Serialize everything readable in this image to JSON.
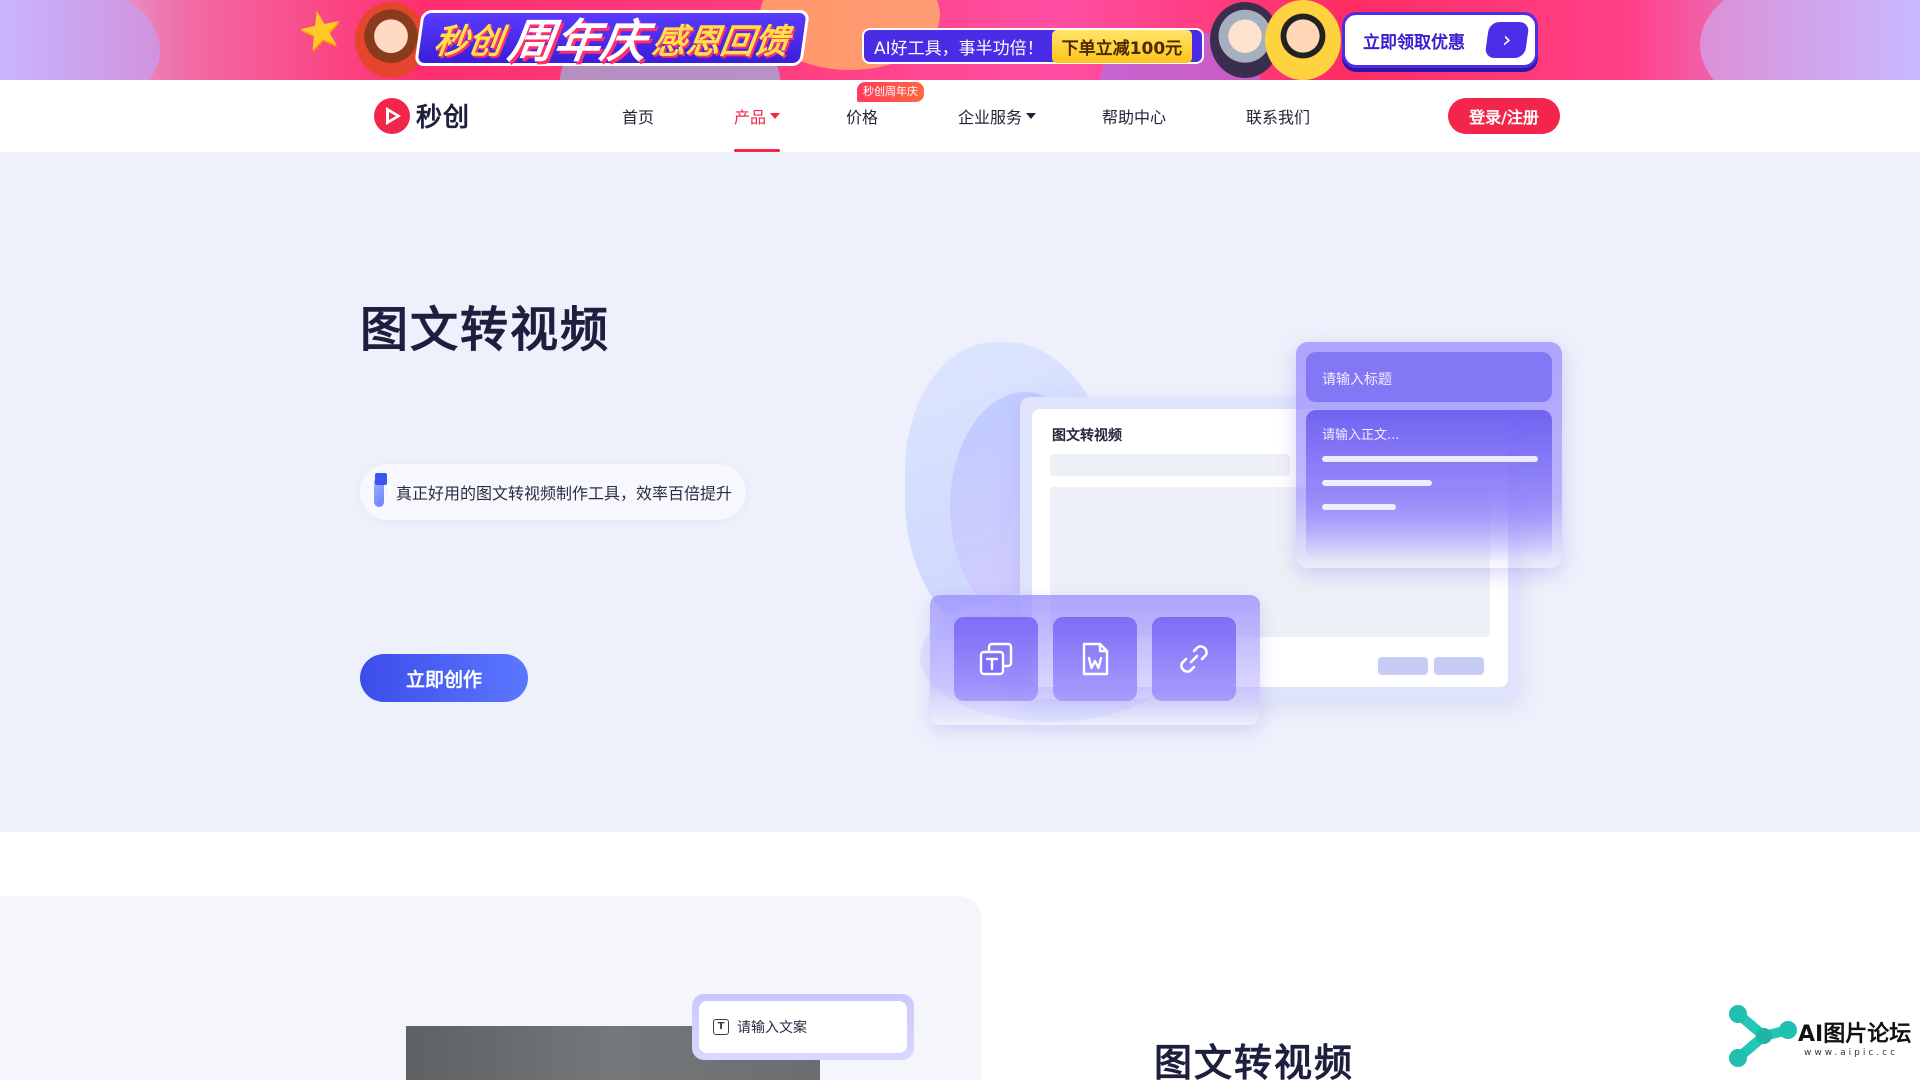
{
  "banner": {
    "title_part1": "秒创",
    "title_part2": "周年庆",
    "title_part3": "感恩回馈",
    "subtitle": "AI好工具，事半功倍！",
    "offer": "下单立减100元",
    "cta_label": "立即领取优惠",
    "colors": {
      "accent": "#4d2ee8",
      "brand": "#ff2f6f"
    }
  },
  "nav": {
    "logo_text": "秒创",
    "items": [
      {
        "label": "首页"
      },
      {
        "label": "产品",
        "active": true,
        "has_dropdown": true
      },
      {
        "label": "价格",
        "badge": "秒创周年庆"
      },
      {
        "label": "企业服务",
        "has_dropdown": true
      },
      {
        "label": "帮助中心"
      },
      {
        "label": "联系我们"
      }
    ],
    "login_label": "登录/注册",
    "colors": {
      "brand": "#f2264a"
    }
  },
  "hero": {
    "title": "图文转视频",
    "tagline": "真正好用的图文转视频制作工具，效率百倍提升",
    "cta_label": "立即创作",
    "illustration": {
      "window_title": "图文转视频",
      "title_placeholder": "请输入标题",
      "body_placeholder": "请输入正文...",
      "tools": [
        "text-copy-icon",
        "word-document-icon",
        "link-icon"
      ]
    }
  },
  "section2": {
    "input_placeholder": "请输入文案",
    "title": "图文转视频"
  },
  "watermark": {
    "text": "AI图片论坛",
    "sub": "www.aipic.cc"
  }
}
